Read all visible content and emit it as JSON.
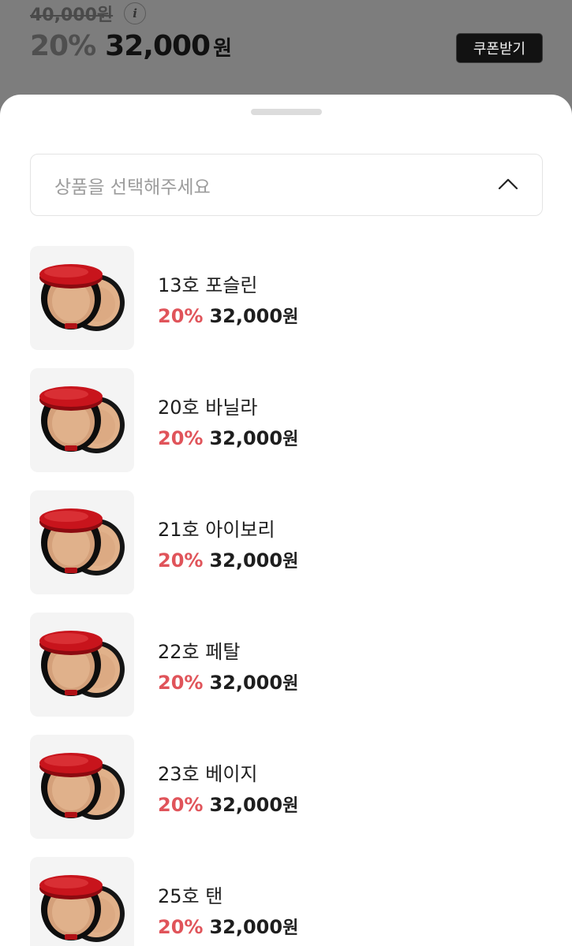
{
  "product": {
    "original_price": "40,000원",
    "info_icon": "i",
    "discount_rate": "20%",
    "sale_price": "32,000",
    "currency": "원",
    "coupon_button": "쿠폰받기"
  },
  "sheet": {
    "selector_placeholder": "상품을 선택해주세요",
    "items": [
      {
        "name": "13호 포슬린",
        "rate": "20%",
        "price": "32,000",
        "currency": "원"
      },
      {
        "name": "20호 바닐라",
        "rate": "20%",
        "price": "32,000",
        "currency": "원"
      },
      {
        "name": "21호 아이보리",
        "rate": "20%",
        "price": "32,000",
        "currency": "원"
      },
      {
        "name": "22호 페탈",
        "rate": "20%",
        "price": "32,000",
        "currency": "원"
      },
      {
        "name": "23호 베이지",
        "rate": "20%",
        "price": "32,000",
        "currency": "원"
      },
      {
        "name": "25호 탠",
        "rate": "20%",
        "price": "32,000",
        "currency": "원"
      }
    ]
  },
  "colors": {
    "discount": "#e0545a",
    "overlay": "#7d7d7d",
    "coupon_bg": "#121212",
    "compact_red": "#c8141c"
  }
}
